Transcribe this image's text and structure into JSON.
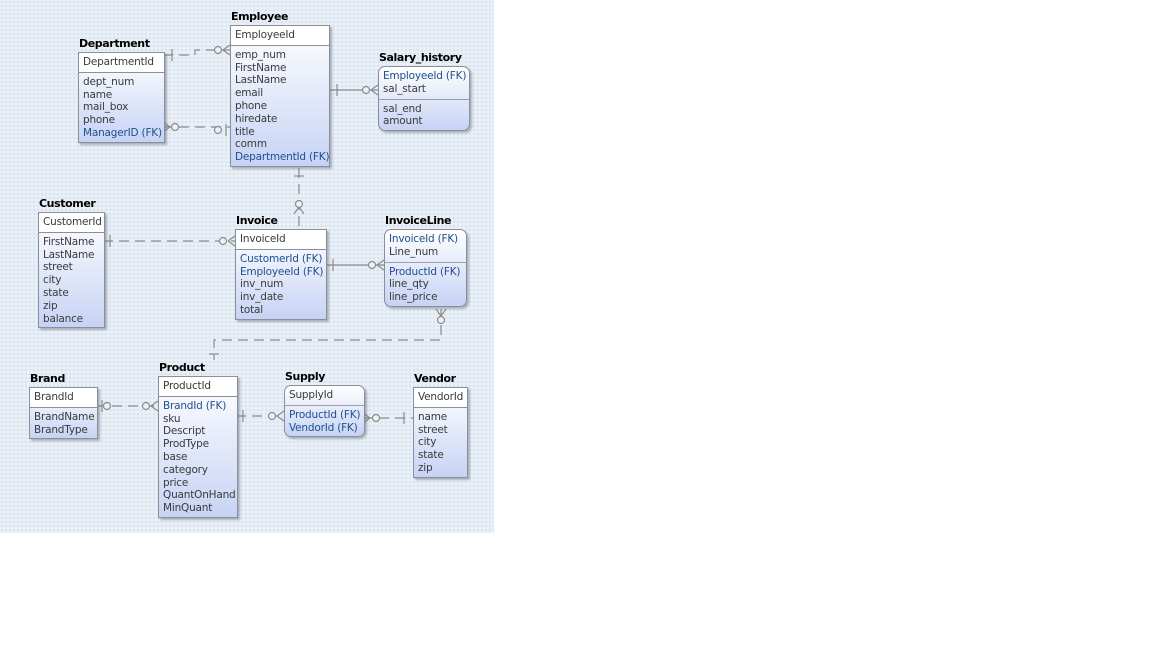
{
  "entities": [
    {
      "id": "employee",
      "name": "Employee",
      "rounded": false,
      "keys": [
        "EmployeeId"
      ],
      "attrs": [
        "emp_num",
        "FirstName",
        "LastName",
        "email",
        "phone",
        "hiredate",
        "title",
        "comm",
        "DepartmentId (FK)"
      ]
    },
    {
      "id": "department",
      "name": "Department",
      "rounded": false,
      "keys": [
        "DepartmentId"
      ],
      "attrs": [
        "dept_num",
        "name",
        "mail_box",
        "phone",
        "ManagerID (FK)"
      ]
    },
    {
      "id": "salary_history",
      "name": "Salary_history",
      "rounded": true,
      "keys": [
        "EmployeeId (FK)",
        "sal_start"
      ],
      "attrs": [
        "sal_end",
        "amount"
      ]
    },
    {
      "id": "customer",
      "name": "Customer",
      "rounded": false,
      "keys": [
        "CustomerId"
      ],
      "attrs": [
        "FirstName",
        "LastName",
        "street",
        "city",
        "state",
        "zip",
        "balance"
      ]
    },
    {
      "id": "invoice",
      "name": "Invoice",
      "rounded": false,
      "keys": [
        "InvoiceId"
      ],
      "attrs": [
        "CustomerId (FK)",
        "EmployeeId (FK)",
        "inv_num",
        "inv_date",
        "total"
      ]
    },
    {
      "id": "invoiceline",
      "name": "InvoiceLine",
      "rounded": true,
      "keys": [
        "InvoiceId (FK)",
        "Line_num"
      ],
      "attrs": [
        "ProductId (FK)",
        "line_qty",
        "line_price"
      ]
    },
    {
      "id": "brand",
      "name": "Brand",
      "rounded": false,
      "keys": [
        "BrandId"
      ],
      "attrs": [
        "BrandName",
        "BrandType"
      ]
    },
    {
      "id": "product",
      "name": "Product",
      "rounded": false,
      "keys": [
        "ProductId"
      ],
      "attrs": [
        "BrandId (FK)",
        "sku",
        "Descript",
        "ProdType",
        "base",
        "category",
        "price",
        "QuantOnHand",
        "MinQuant"
      ]
    },
    {
      "id": "supply",
      "name": "Supply",
      "rounded": true,
      "keys": [
        "SupplyId"
      ],
      "attrs": [
        "ProductId (FK)",
        "VendorId (FK)"
      ]
    },
    {
      "id": "vendor",
      "name": "Vendor",
      "rounded": false,
      "keys": [
        "VendorId"
      ],
      "attrs": [
        "name",
        "street",
        "city",
        "state",
        "zip"
      ]
    }
  ],
  "relationships": [
    {
      "from": "Department",
      "to": "Employee"
    },
    {
      "from": "Employee",
      "to": "Department"
    },
    {
      "from": "Employee",
      "to": "Salary_history"
    },
    {
      "from": "Employee",
      "to": "Invoice"
    },
    {
      "from": "Customer",
      "to": "Invoice"
    },
    {
      "from": "Invoice",
      "to": "InvoiceLine"
    },
    {
      "from": "Product",
      "to": "InvoiceLine"
    },
    {
      "from": "Brand",
      "to": "Product"
    },
    {
      "from": "Product",
      "to": "Supply"
    },
    {
      "from": "Vendor",
      "to": "Supply"
    }
  ],
  "colors": {
    "line": "#8c8c8c",
    "fk_text": "#1f4f8f",
    "background": "#e9eff6"
  }
}
